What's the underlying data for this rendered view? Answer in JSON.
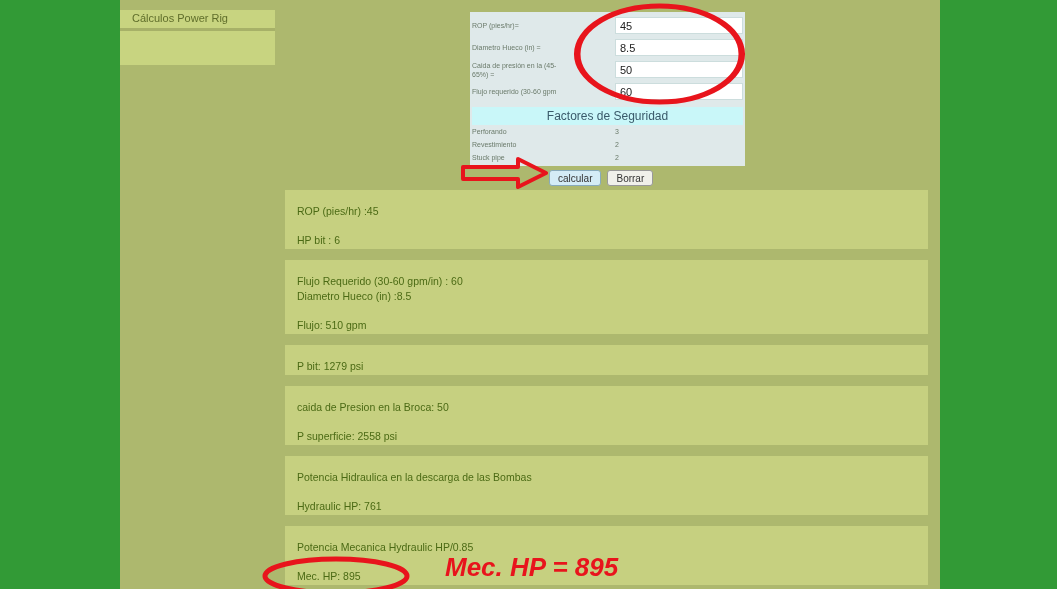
{
  "sidebar": {
    "items": [
      {
        "label": "Cálculos Power Rig",
        "selected": false
      }
    ]
  },
  "form": {
    "fields": [
      {
        "label": "ROP (pies/hr)=",
        "value": "45"
      },
      {
        "label": "Diametro Hueco (in) =",
        "value": "8.5"
      },
      {
        "label": "Caida de presión en la (45-65%) =",
        "value": "50"
      },
      {
        "label": "Flujo requerido (30-60 gpm",
        "value": "60"
      }
    ],
    "safety_title": "Factores de Seguridad",
    "safety_factors": [
      {
        "label": "Perforando",
        "value": "3"
      },
      {
        "label": "Revestimiento",
        "value": "2"
      },
      {
        "label": "Stuck pipe",
        "value": "2"
      }
    ],
    "buttons": [
      {
        "label": "calcular",
        "kind": "primary"
      },
      {
        "label": "Borrar",
        "kind": "secondary"
      }
    ]
  },
  "results": [
    {
      "groups": [
        [
          "ROP (pies/hr) :45"
        ],
        [
          "HP bit : 6"
        ]
      ]
    },
    {
      "groups": [
        [
          "Flujo Requerido (30-60 gpm/in) : 60",
          "Diametro Hueco (in) :8.5"
        ],
        [
          "Flujo: 510 gpm"
        ]
      ]
    },
    {
      "groups": [
        [
          "P bit: 1279 psi"
        ]
      ]
    },
    {
      "groups": [
        [
          "caida de Presion en la Broca: 50"
        ],
        [
          "P superficie: 2558 psi"
        ]
      ]
    },
    {
      "groups": [
        [
          "Potencia Hidraulica en la descarga de las Bombas"
        ],
        [
          "Hydraulic HP: 761"
        ]
      ]
    },
    {
      "groups": [
        [
          "Potencia Mecanica Hydraulic HP/0.85"
        ],
        [
          "Mec. HP: 895"
        ]
      ]
    }
  ],
  "annotation": {
    "callout": "Mec. HP = 895"
  }
}
